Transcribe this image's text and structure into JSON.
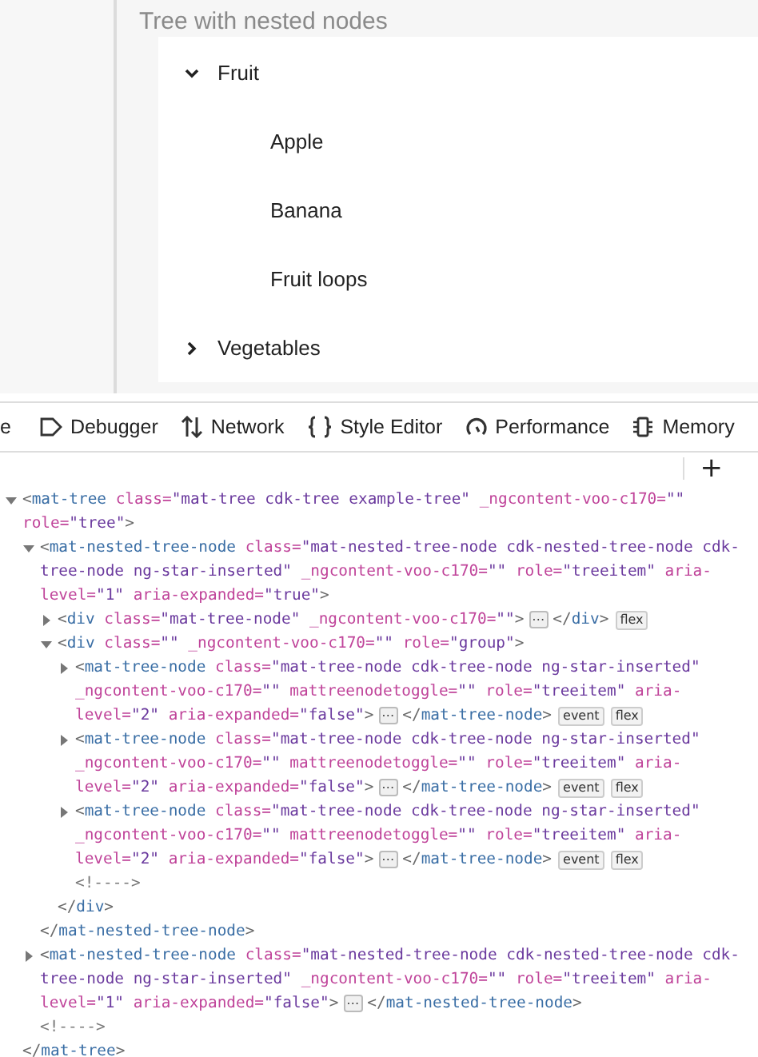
{
  "demo": {
    "title": "Tree with nested nodes",
    "tree": [
      {
        "label": "Fruit",
        "expanded": true,
        "children": [
          {
            "label": "Apple"
          },
          {
            "label": "Banana"
          },
          {
            "label": "Fruit loops"
          }
        ]
      },
      {
        "label": "Vegetables",
        "expanded": false
      }
    ]
  },
  "devtools_tabs": [
    {
      "kind": "cut",
      "label": "e"
    },
    {
      "kind": "debugger",
      "label": "Debugger"
    },
    {
      "kind": "network",
      "label": "Network"
    },
    {
      "kind": "style",
      "label": "Style Editor"
    },
    {
      "kind": "performance",
      "label": "Performance"
    },
    {
      "kind": "memory",
      "label": "Memory"
    }
  ],
  "toolbar": {
    "add_button": "+"
  },
  "markup": [
    {
      "kind": "element",
      "expanded": true,
      "lines": [
        [
          {
            "kind": "punct",
            "text": "<"
          },
          {
            "kind": "tag",
            "text": "mat-tree"
          },
          {
            "kind": "attr",
            "text": " class="
          },
          {
            "kind": "value",
            "text": "\"mat-tree cdk-tree example-tree\""
          },
          {
            "kind": "attr",
            "text": " _ngcontent-voo-c170="
          },
          {
            "kind": "value",
            "text": "\"\""
          }
        ],
        [
          {
            "kind": "attr",
            "text": "role="
          },
          {
            "kind": "value",
            "text": "\"tree\""
          },
          {
            "kind": "punct",
            "text": ">"
          }
        ]
      ],
      "children": [
        {
          "kind": "element",
          "expanded": true,
          "lines": [
            [
              {
                "kind": "punct",
                "text": "<"
              },
              {
                "kind": "tag",
                "text": "mat-nested-tree-node"
              },
              {
                "kind": "attr",
                "text": " class="
              },
              {
                "kind": "value",
                "text": "\"mat-nested-tree-node cdk-nested-tree-node cdk-"
              }
            ],
            [
              {
                "kind": "value",
                "text": "tree-node ng-star-inserted\""
              },
              {
                "kind": "attr",
                "text": " _ngcontent-voo-c170="
              },
              {
                "kind": "value",
                "text": "\"\""
              },
              {
                "kind": "attr",
                "text": " role="
              },
              {
                "kind": "value",
                "text": "\"treeitem\""
              },
              {
                "kind": "attr",
                "text": " aria-"
              }
            ],
            [
              {
                "kind": "attr",
                "text": "level="
              },
              {
                "kind": "value",
                "text": "\"1\""
              },
              {
                "kind": "attr",
                "text": " aria-expanded="
              },
              {
                "kind": "value",
                "text": "\"true\""
              },
              {
                "kind": "punct",
                "text": ">"
              }
            ]
          ],
          "children": [
            {
              "kind": "element",
              "expanded": false,
              "lines": [
                [
                  {
                    "kind": "punct",
                    "text": "<"
                  },
                  {
                    "kind": "tag",
                    "text": "div"
                  },
                  {
                    "kind": "attr",
                    "text": " class="
                  },
                  {
                    "kind": "value",
                    "text": "\"mat-tree-node\""
                  },
                  {
                    "kind": "attr",
                    "text": " _ngcontent-voo-c170="
                  },
                  {
                    "kind": "value",
                    "text": "\"\""
                  },
                  {
                    "kind": "punct",
                    "text": ">"
                  },
                  {
                    "kind": "more",
                    "text": "⋯"
                  },
                  {
                    "kind": "punct",
                    "text": "</"
                  },
                  {
                    "kind": "tag",
                    "text": "div"
                  },
                  {
                    "kind": "punct",
                    "text": ">"
                  },
                  {
                    "kind": "badge",
                    "text": "flex"
                  }
                ]
              ]
            },
            {
              "kind": "element",
              "expanded": true,
              "lines": [
                [
                  {
                    "kind": "punct",
                    "text": "<"
                  },
                  {
                    "kind": "tag",
                    "text": "div"
                  },
                  {
                    "kind": "attr",
                    "text": " class="
                  },
                  {
                    "kind": "value",
                    "text": "\"\""
                  },
                  {
                    "kind": "attr",
                    "text": " _ngcontent-voo-c170="
                  },
                  {
                    "kind": "value",
                    "text": "\"\""
                  },
                  {
                    "kind": "attr",
                    "text": " role="
                  },
                  {
                    "kind": "value",
                    "text": "\"group\""
                  },
                  {
                    "kind": "punct",
                    "text": ">"
                  }
                ]
              ],
              "children": [
                {
                  "kind": "element",
                  "expanded": false,
                  "lines": [
                    [
                      {
                        "kind": "punct",
                        "text": "<"
                      },
                      {
                        "kind": "tag",
                        "text": "mat-tree-node"
                      },
                      {
                        "kind": "attr",
                        "text": " class="
                      },
                      {
                        "kind": "value",
                        "text": "\"mat-tree-node cdk-tree-node ng-star-inserted\""
                      }
                    ],
                    [
                      {
                        "kind": "attr",
                        "text": "_ngcontent-voo-c170="
                      },
                      {
                        "kind": "value",
                        "text": "\"\""
                      },
                      {
                        "kind": "attr",
                        "text": " mattreenodetoggle="
                      },
                      {
                        "kind": "value",
                        "text": "\"\""
                      },
                      {
                        "kind": "attr",
                        "text": " role="
                      },
                      {
                        "kind": "value",
                        "text": "\"treeitem\""
                      },
                      {
                        "kind": "attr",
                        "text": " aria-"
                      }
                    ],
                    [
                      {
                        "kind": "attr",
                        "text": "level="
                      },
                      {
                        "kind": "value",
                        "text": "\"2\""
                      },
                      {
                        "kind": "attr",
                        "text": " aria-expanded="
                      },
                      {
                        "kind": "value",
                        "text": "\"false\""
                      },
                      {
                        "kind": "punct",
                        "text": ">"
                      },
                      {
                        "kind": "more",
                        "text": "⋯"
                      },
                      {
                        "kind": "punct",
                        "text": "</"
                      },
                      {
                        "kind": "tag",
                        "text": "mat-tree-node"
                      },
                      {
                        "kind": "punct",
                        "text": ">"
                      },
                      {
                        "kind": "badge",
                        "text": "event"
                      },
                      {
                        "kind": "badge",
                        "text": "flex"
                      }
                    ]
                  ]
                },
                {
                  "kind": "element",
                  "expanded": false,
                  "lines": [
                    [
                      {
                        "kind": "punct",
                        "text": "<"
                      },
                      {
                        "kind": "tag",
                        "text": "mat-tree-node"
                      },
                      {
                        "kind": "attr",
                        "text": " class="
                      },
                      {
                        "kind": "value",
                        "text": "\"mat-tree-node cdk-tree-node ng-star-inserted\""
                      }
                    ],
                    [
                      {
                        "kind": "attr",
                        "text": "_ngcontent-voo-c170="
                      },
                      {
                        "kind": "value",
                        "text": "\"\""
                      },
                      {
                        "kind": "attr",
                        "text": " mattreenodetoggle="
                      },
                      {
                        "kind": "value",
                        "text": "\"\""
                      },
                      {
                        "kind": "attr",
                        "text": " role="
                      },
                      {
                        "kind": "value",
                        "text": "\"treeitem\""
                      },
                      {
                        "kind": "attr",
                        "text": " aria-"
                      }
                    ],
                    [
                      {
                        "kind": "attr",
                        "text": "level="
                      },
                      {
                        "kind": "value",
                        "text": "\"2\""
                      },
                      {
                        "kind": "attr",
                        "text": " aria-expanded="
                      },
                      {
                        "kind": "value",
                        "text": "\"false\""
                      },
                      {
                        "kind": "punct",
                        "text": ">"
                      },
                      {
                        "kind": "more",
                        "text": "⋯"
                      },
                      {
                        "kind": "punct",
                        "text": "</"
                      },
                      {
                        "kind": "tag",
                        "text": "mat-tree-node"
                      },
                      {
                        "kind": "punct",
                        "text": ">"
                      },
                      {
                        "kind": "badge",
                        "text": "event"
                      },
                      {
                        "kind": "badge",
                        "text": "flex"
                      }
                    ]
                  ]
                },
                {
                  "kind": "element",
                  "expanded": false,
                  "lines": [
                    [
                      {
                        "kind": "punct",
                        "text": "<"
                      },
                      {
                        "kind": "tag",
                        "text": "mat-tree-node"
                      },
                      {
                        "kind": "attr",
                        "text": " class="
                      },
                      {
                        "kind": "value",
                        "text": "\"mat-tree-node cdk-tree-node ng-star-inserted\""
                      }
                    ],
                    [
                      {
                        "kind": "attr",
                        "text": "_ngcontent-voo-c170="
                      },
                      {
                        "kind": "value",
                        "text": "\"\""
                      },
                      {
                        "kind": "attr",
                        "text": " mattreenodetoggle="
                      },
                      {
                        "kind": "value",
                        "text": "\"\""
                      },
                      {
                        "kind": "attr",
                        "text": " role="
                      },
                      {
                        "kind": "value",
                        "text": "\"treeitem\""
                      },
                      {
                        "kind": "attr",
                        "text": " aria-"
                      }
                    ],
                    [
                      {
                        "kind": "attr",
                        "text": "level="
                      },
                      {
                        "kind": "value",
                        "text": "\"2\""
                      },
                      {
                        "kind": "attr",
                        "text": " aria-expanded="
                      },
                      {
                        "kind": "value",
                        "text": "\"false\""
                      },
                      {
                        "kind": "punct",
                        "text": ">"
                      },
                      {
                        "kind": "more",
                        "text": "⋯"
                      },
                      {
                        "kind": "punct",
                        "text": "</"
                      },
                      {
                        "kind": "tag",
                        "text": "mat-tree-node"
                      },
                      {
                        "kind": "punct",
                        "text": ">"
                      },
                      {
                        "kind": "badge",
                        "text": "event"
                      },
                      {
                        "kind": "badge",
                        "text": "flex"
                      }
                    ]
                  ]
                },
                {
                  "kind": "comment",
                  "lines": [
                    [
                      {
                        "kind": "comment",
                        "text": "<!---->"
                      }
                    ]
                  ]
                }
              ],
              "closing": [
                {
                  "kind": "punct",
                  "text": "</"
                },
                {
                  "kind": "tag",
                  "text": "div"
                },
                {
                  "kind": "punct",
                  "text": ">"
                }
              ]
            }
          ],
          "closing": [
            {
              "kind": "punct",
              "text": "</"
            },
            {
              "kind": "tag",
              "text": "mat-nested-tree-node"
            },
            {
              "kind": "punct",
              "text": ">"
            }
          ]
        },
        {
          "kind": "element",
          "expanded": false,
          "lines": [
            [
              {
                "kind": "punct",
                "text": "<"
              },
              {
                "kind": "tag",
                "text": "mat-nested-tree-node"
              },
              {
                "kind": "attr",
                "text": " class="
              },
              {
                "kind": "value",
                "text": "\"mat-nested-tree-node cdk-nested-tree-node cdk-"
              }
            ],
            [
              {
                "kind": "value",
                "text": "tree-node ng-star-inserted\""
              },
              {
                "kind": "attr",
                "text": " _ngcontent-voo-c170="
              },
              {
                "kind": "value",
                "text": "\"\""
              },
              {
                "kind": "attr",
                "text": " role="
              },
              {
                "kind": "value",
                "text": "\"treeitem\""
              },
              {
                "kind": "attr",
                "text": " aria-"
              }
            ],
            [
              {
                "kind": "attr",
                "text": "level="
              },
              {
                "kind": "value",
                "text": "\"1\""
              },
              {
                "kind": "attr",
                "text": " aria-expanded="
              },
              {
                "kind": "value",
                "text": "\"false\""
              },
              {
                "kind": "punct",
                "text": ">"
              },
              {
                "kind": "more",
                "text": "⋯"
              },
              {
                "kind": "punct",
                "text": "</"
              },
              {
                "kind": "tag",
                "text": "mat-nested-tree-node"
              },
              {
                "kind": "punct",
                "text": ">"
              }
            ]
          ]
        },
        {
          "kind": "comment",
          "lines": [
            [
              {
                "kind": "comment",
                "text": "<!---->"
              }
            ]
          ]
        }
      ],
      "closing": [
        {
          "kind": "punct",
          "text": "</"
        },
        {
          "kind": "tag",
          "text": "mat-tree"
        },
        {
          "kind": "punct",
          "text": ">"
        }
      ]
    }
  ]
}
